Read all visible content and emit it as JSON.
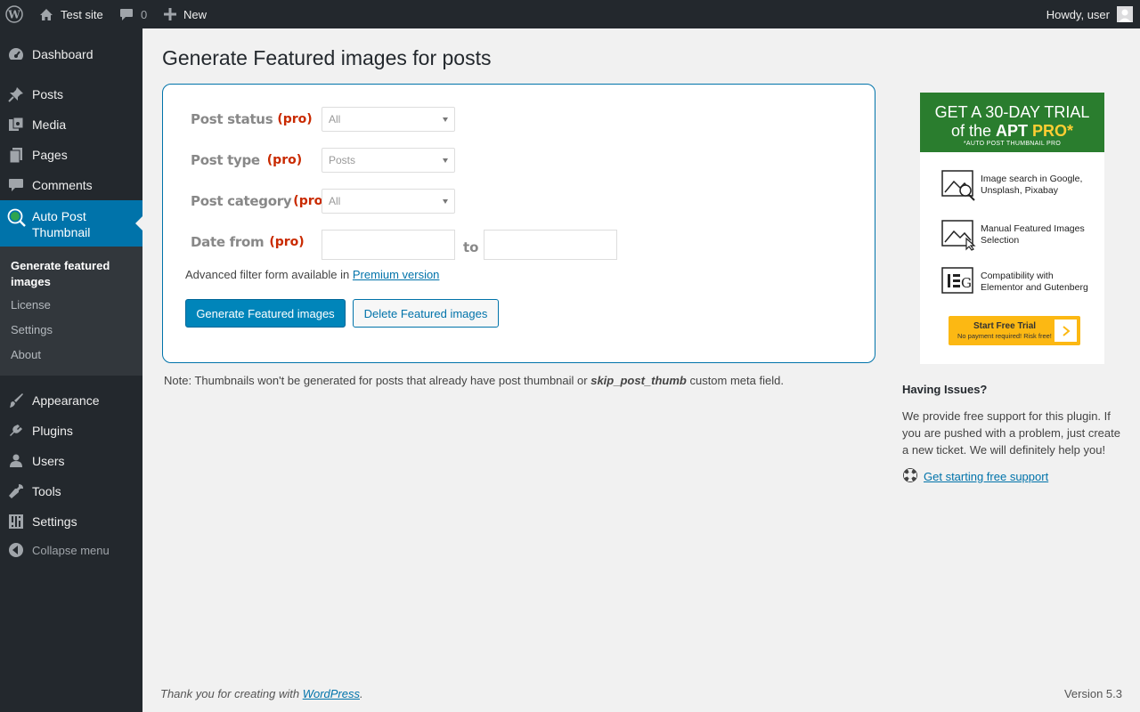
{
  "admin_bar": {
    "site_name": "Test site",
    "comments_count": "0",
    "new_label": "New",
    "howdy": "Howdy, user"
  },
  "sidebar": {
    "items_top": [
      {
        "label": "Dashboard",
        "icon": "dashboard-icon"
      },
      {
        "label": "Posts",
        "icon": "pin-icon"
      },
      {
        "label": "Media",
        "icon": "media-icon"
      },
      {
        "label": "Pages",
        "icon": "pages-icon"
      },
      {
        "label": "Comments",
        "icon": "comment-icon"
      }
    ],
    "active": {
      "label": "Auto Post Thumbnail",
      "icon": "apt-icon"
    },
    "submenu": [
      "Generate featured images",
      "License",
      "Settings",
      "About"
    ],
    "items_bottom": [
      {
        "label": "Appearance",
        "icon": "brush-icon"
      },
      {
        "label": "Plugins",
        "icon": "plug-icon"
      },
      {
        "label": "Users",
        "icon": "user-icon"
      },
      {
        "label": "Tools",
        "icon": "wrench-icon"
      },
      {
        "label": "Settings",
        "icon": "settings-icon"
      }
    ],
    "collapse_label": "Collapse menu"
  },
  "main": {
    "title": "Generate Featured images for posts",
    "form": {
      "post_status_label": "Post status",
      "post_status_value": "All",
      "post_type_label": "Post type",
      "post_type_value": "Posts",
      "post_category_label": "Post category",
      "post_category_value": "All",
      "date_from_label": "Date from",
      "to_label": "to",
      "pro_tag": "(pro)",
      "advanced_note": "Advanced filter form available in",
      "premium_link": "Premium version",
      "generate_button": "Generate Featured images",
      "delete_button": "Delete Featured images"
    },
    "note_prefix": "Note: Thumbnails won't be generated for posts that already have post thumbnail or",
    "note_field": "skip_post_thumb",
    "note_suffix": "custom meta field."
  },
  "promo": {
    "line1": "GET A 30-DAY TRIAL",
    "line2_of": "of the",
    "line2_apt": "APT",
    "line2_pro": "PRO",
    "line2_star": "*",
    "line3": "*AUTO POST THUMBNAIL PRO",
    "features": [
      "Image search in Google, Unsplash, Pixabay",
      "Manual Featured Images Selection",
      "Compatibility with Elementor and Gutenberg"
    ],
    "cta_main": "Start Free Trial",
    "cta_sub": "No payment required! Risk free!",
    "accent_color": "#2a7d2e",
    "cta_color": "#fcb813"
  },
  "support": {
    "title": "Having Issues?",
    "text": "We provide free support for this plugin. If you are pushed with a problem, just create a new ticket. We will definitely help you!",
    "link": "Get starting free support"
  },
  "footer": {
    "thanks_prefix": "Thank you for creating with",
    "thanks_link": "WordPress",
    "thanks_suffix": ".",
    "version": "Version 5.3"
  },
  "colors": {
    "admin_bg": "#23282d",
    "active_blue": "#0073aa",
    "pro_red": "#c92a00"
  }
}
